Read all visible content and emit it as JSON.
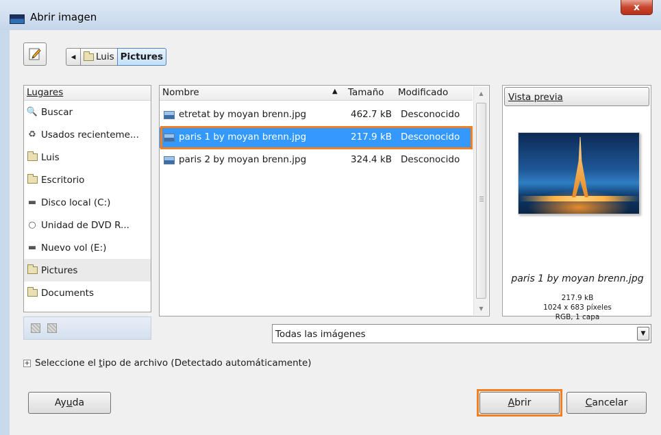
{
  "window": {
    "title": "Abrir imagen",
    "close_label": "x"
  },
  "toolbar": {
    "back_glyph": "◂",
    "breadcrumbs": [
      {
        "label": "Luis"
      },
      {
        "label": "Pictures"
      }
    ]
  },
  "places": {
    "header": "Lugares",
    "items": [
      {
        "label": "Buscar",
        "icon": "search-icon"
      },
      {
        "label": "Usados recienteme...",
        "icon": "recent-icon"
      },
      {
        "label": "Luis",
        "icon": "folder-icon"
      },
      {
        "label": "Escritorio",
        "icon": "folder-icon"
      },
      {
        "label": "Disco local (C:)",
        "icon": "drive-icon"
      },
      {
        "label": "Unidad de DVD R...",
        "icon": "dvd-icon"
      },
      {
        "label": "Nuevo vol (E:)",
        "icon": "drive-icon"
      },
      {
        "label": "Pictures",
        "icon": "folder-icon"
      },
      {
        "label": "Documents",
        "icon": "folder-icon"
      }
    ]
  },
  "files": {
    "columns": {
      "name": "Nombre",
      "size": "Tamaño",
      "modified": "Modificado"
    },
    "rows": [
      {
        "name": "etretat by moyan brenn.jpg",
        "size": "462.7 kB",
        "modified": "Desconocido"
      },
      {
        "name": "paris 1 by moyan brenn.jpg",
        "size": "217.9 kB",
        "modified": "Desconocido"
      },
      {
        "name": "paris 2 by moyan brenn.jpg",
        "size": "324.4 kB",
        "modified": "Desconocido"
      }
    ]
  },
  "preview": {
    "button_label": "Vista previa",
    "file_name": "paris 1 by moyan brenn.jpg",
    "size": "217.9 kB",
    "dimensions": "1024 x 683 píxeles",
    "mode": "RGB, 1 capa"
  },
  "filter": {
    "selected": "Todas las imágenes"
  },
  "file_type": {
    "prefix": "Seleccione el ",
    "mnemonic": "t",
    "suffix": "ipo de archivo (Detectado automáticamente)"
  },
  "buttons": {
    "help": {
      "prefix": "Ay",
      "mnemonic": "u",
      "suffix": "da"
    },
    "open": {
      "prefix": "",
      "mnemonic": "A",
      "suffix": "brir"
    },
    "cancel": {
      "prefix": "",
      "mnemonic": "C",
      "suffix": "ancelar"
    }
  },
  "colors": {
    "selection": "#3399ff",
    "highlight": "#f47f22"
  }
}
